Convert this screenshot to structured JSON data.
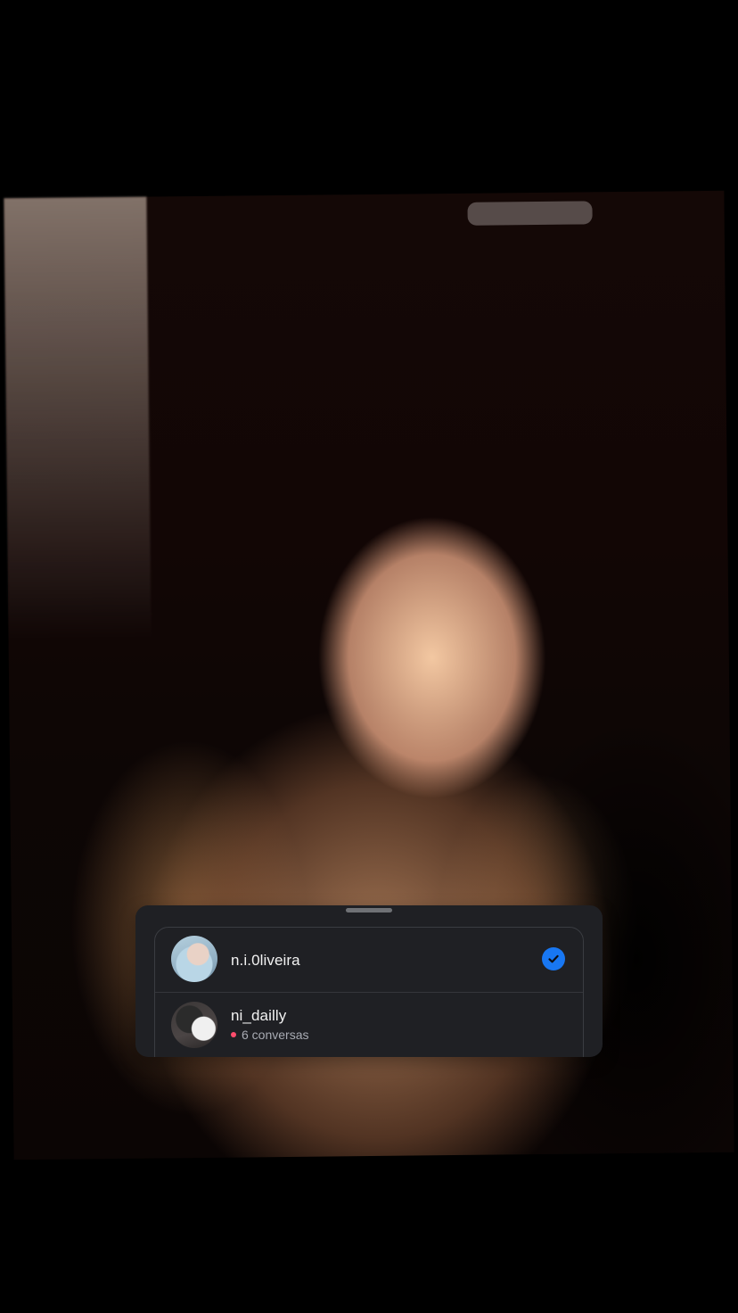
{
  "photo": {
    "description_label": "photo"
  },
  "accounts_panel": {
    "items": [
      {
        "username": "n.i.0liveira",
        "selected": true
      },
      {
        "username": "ni_dailly",
        "subtitle": "6 conversas",
        "unread_indicator": true
      }
    ]
  },
  "colors": {
    "panel_background": "#1f2024",
    "selected_check": "#1877f2",
    "unread_dot": "#ff4d6d"
  },
  "icons": {
    "selected": "checkmark-circle-icon",
    "unread": "dot-icon"
  }
}
